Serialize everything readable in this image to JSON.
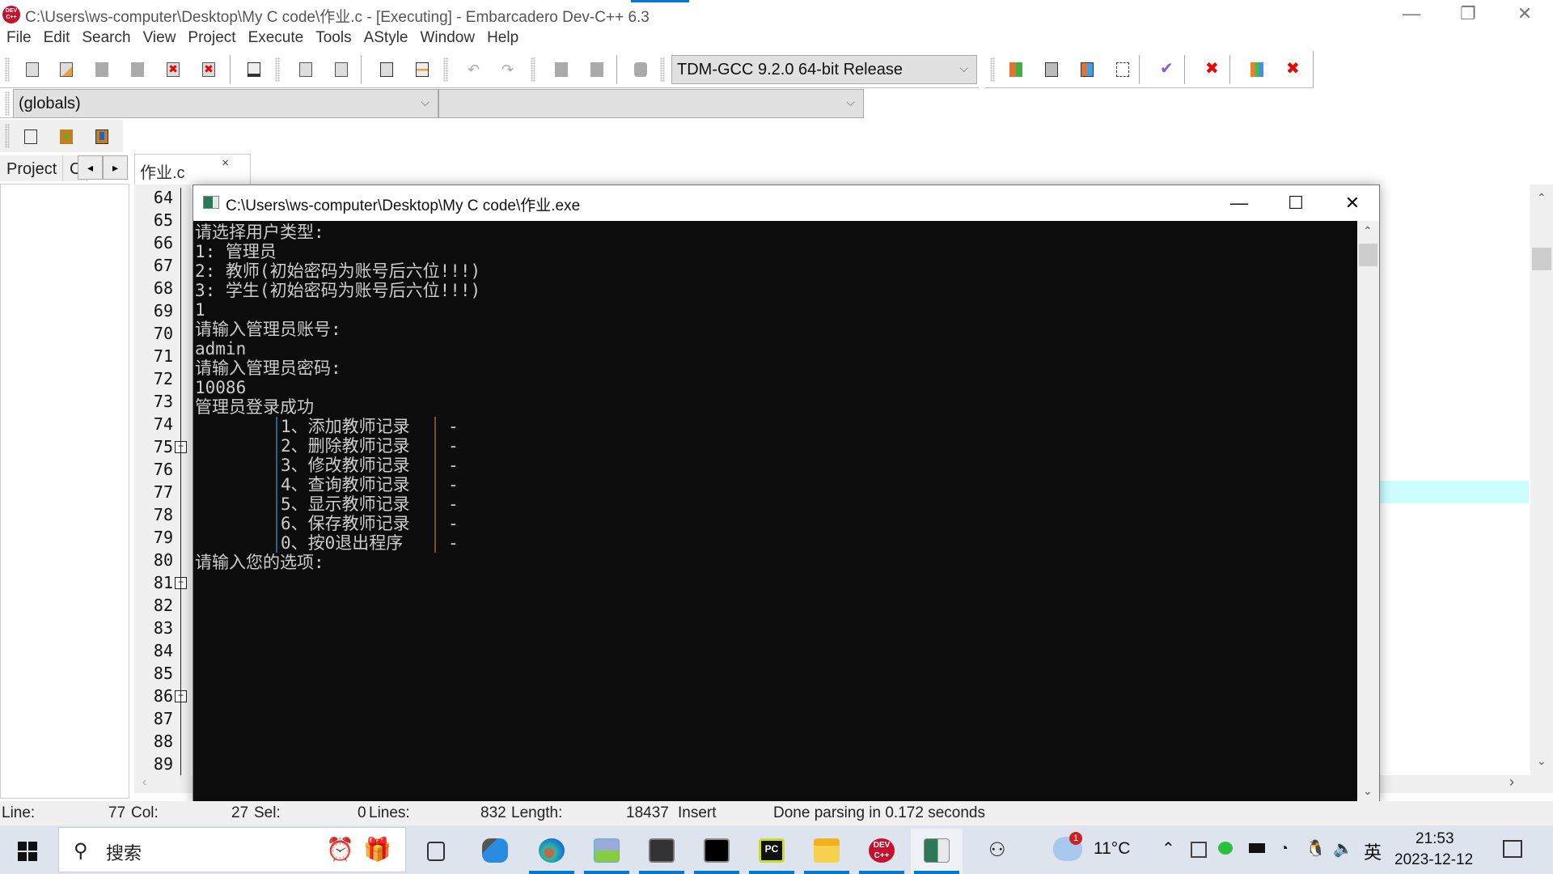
{
  "window": {
    "title": "C:\\Users\\ws-computer\\Desktop\\My C code\\作业.c - [Executing] - Embarcadero Dev-C++ 6.3",
    "app_icon_label": "DEV C++",
    "minimize_glyph": "—",
    "restore_glyph": "❐",
    "close_glyph": "✕"
  },
  "menu": [
    "File",
    "Edit",
    "Search",
    "View",
    "Project",
    "Execute",
    "Tools",
    "AStyle",
    "Window",
    "Help"
  ],
  "toolbar": {
    "compiler_select": "TDM-GCC 9.2.0 64-bit Release",
    "scope_select": "(globals)",
    "function_select": ""
  },
  "left_panel": {
    "tabs": [
      "Project",
      "C"
    ],
    "nav_prev": "◂",
    "nav_next": "▸"
  },
  "editor": {
    "tab_label": "作业.c",
    "tab_close": "×",
    "line_numbers": [
      "64",
      "65",
      "66",
      "67",
      "68",
      "69",
      "70",
      "71",
      "72",
      "73",
      "74",
      "75",
      "76",
      "77",
      "78",
      "79",
      "80",
      "81",
      "82",
      "83",
      "84",
      "85",
      "86",
      "87",
      "88",
      "89"
    ],
    "fold_markers": [
      "75",
      "81",
      "86"
    ],
    "current_line": "77"
  },
  "console": {
    "title": "C:\\Users\\ws-computer\\Desktop\\My C code\\作业.exe",
    "lines": [
      "请选择用户类型:",
      "1: 管理员",
      "2: 教师(初始密码为账号后六位!!!)",
      "3: 学生(初始密码为账号后六位!!!)",
      "1",
      "请输入管理员账号:",
      "admin",
      "请输入管理员密码:",
      "10086",
      "管理员登录成功"
    ],
    "menu_items": [
      "1、添加教师记录",
      "2、删除教师记录",
      "3、修改教师记录",
      "4、查询教师记录",
      "5、显示教师记录",
      "6、保存教师记录",
      "0、按0退出程序"
    ],
    "menu_dash": "-",
    "prompt": "请输入您的选项:"
  },
  "statusbar": {
    "line_label": "Line:",
    "line_value": "77",
    "col_label": "Col:",
    "col_value": "27",
    "sel_label": "Sel:",
    "sel_value": "0",
    "lines_label": "Lines:",
    "lines_value": "832",
    "length_label": "Length:",
    "length_value": "18437",
    "mode": "Insert",
    "message": "Done parsing in 0.172 seconds"
  },
  "taskbar": {
    "search_placeholder": "搜索",
    "apps": [
      "task-view",
      "app-blue-link",
      "edge",
      "photos",
      "cmd-1",
      "cmd-2",
      "pycharm",
      "file-explorer",
      "devcpp",
      "console-window"
    ],
    "weather_temp": "11°C",
    "weather_badge": "1",
    "ime": "英",
    "time": "21:53",
    "date": "2023-12-12"
  }
}
